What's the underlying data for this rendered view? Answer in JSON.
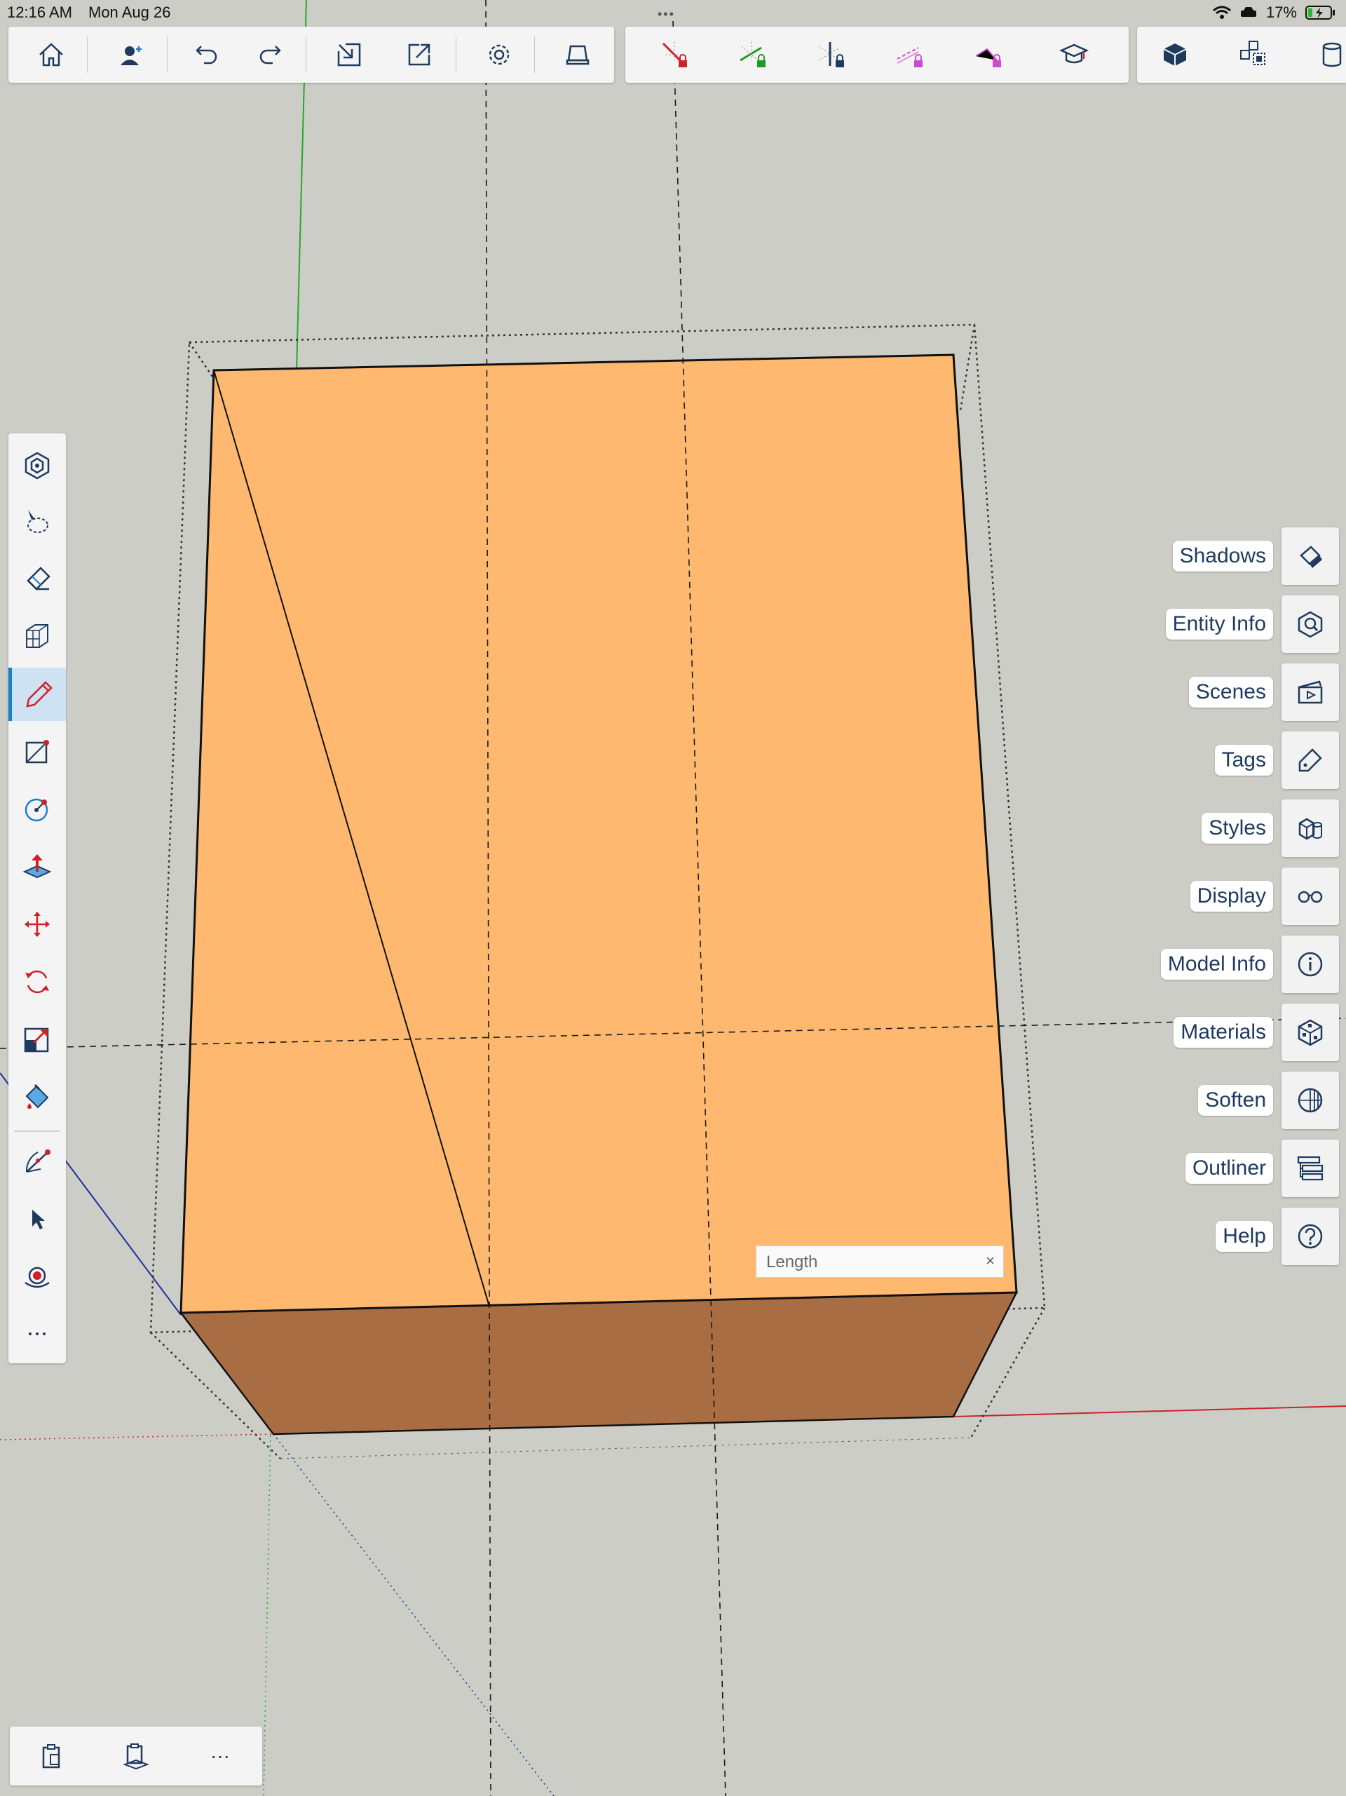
{
  "status_bar": {
    "time": "12:16 AM",
    "date": "Mon Aug 26",
    "battery": "17%"
  },
  "toolbar_left": [
    {
      "name": "home-icon"
    },
    {
      "name": "user-icon"
    },
    {
      "name": "undo-icon"
    },
    {
      "name": "redo-icon"
    },
    {
      "name": "import-icon"
    },
    {
      "name": "export-icon"
    },
    {
      "name": "settings-icon"
    },
    {
      "name": "ar-view-icon"
    }
  ],
  "toolbar_axis_locks": [
    {
      "name": "lock-red-axis-icon",
      "color": "#d0202a"
    },
    {
      "name": "lock-green-axis-icon",
      "color": "#1f9a2a"
    },
    {
      "name": "lock-blue-axis-icon",
      "color": "#1e3a5f"
    },
    {
      "name": "lock-magenta-axis-icon",
      "color": "#d04ad0"
    },
    {
      "name": "lock-magenta-axis-2-icon",
      "color": "#d04ad0"
    },
    {
      "name": "learn-icon",
      "color": "#1e3a5f"
    }
  ],
  "toolbar_right": [
    {
      "name": "solid-view-icon"
    },
    {
      "name": "component-view-icon"
    },
    {
      "name": "cylinder-view-icon"
    }
  ],
  "left_tools": [
    {
      "name": "components-tool-icon"
    },
    {
      "name": "lasso-select-tool-icon"
    },
    {
      "name": "eraser-tool-icon"
    },
    {
      "name": "box-select-tool-icon"
    },
    {
      "name": "pencil-tool-icon",
      "active": true
    },
    {
      "name": "rectangle-tool-icon"
    },
    {
      "name": "circle-tool-icon"
    },
    {
      "name": "push-pull-tool-icon"
    },
    {
      "name": "move-tool-icon"
    },
    {
      "name": "rotate-tool-icon"
    },
    {
      "name": "scale-tool-icon"
    },
    {
      "name": "paint-bucket-tool-icon"
    },
    {
      "name": "protractor-tool-icon"
    },
    {
      "name": "select-tool-icon"
    },
    {
      "name": "orbit-tool-icon"
    },
    {
      "name": "more-tools-icon"
    }
  ],
  "tray": [
    {
      "label": "Shadows",
      "icon": "shadows-icon"
    },
    {
      "label": "Entity Info",
      "icon": "entity-info-icon"
    },
    {
      "label": "Scenes",
      "icon": "scenes-icon"
    },
    {
      "label": "Tags",
      "icon": "tags-icon"
    },
    {
      "label": "Styles",
      "icon": "styles-icon"
    },
    {
      "label": "Display",
      "icon": "display-icon"
    },
    {
      "label": "Model Info",
      "icon": "model-info-icon"
    },
    {
      "label": "Materials",
      "icon": "materials-icon"
    },
    {
      "label": "Soften",
      "icon": "soften-icon"
    },
    {
      "label": "Outliner",
      "icon": "outliner-icon"
    },
    {
      "label": "Help",
      "icon": "help-icon"
    }
  ],
  "vcb": {
    "label": "Length",
    "close": "×"
  },
  "bottom_bar": [
    {
      "name": "clipboard-icon"
    },
    {
      "name": "paste-in-place-icon"
    },
    {
      "name": "more-icon",
      "text": "···"
    }
  ],
  "colors": {
    "top_face": "#ffb870",
    "front_face": "#a96d43",
    "background": "#cdcdc8",
    "accent": "#1b7fc4"
  }
}
